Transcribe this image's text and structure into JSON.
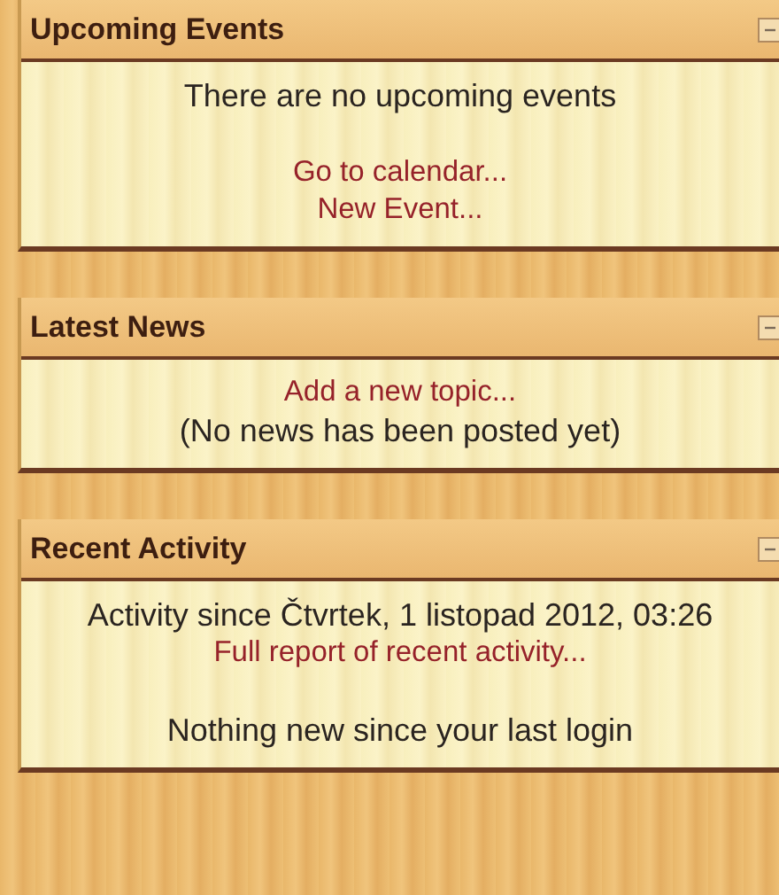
{
  "blocks": [
    {
      "title": "Upcoming Events",
      "expanded": true,
      "paragraphs": [
        [
          {
            "kind": "text",
            "text": "There are no upcoming events"
          }
        ],
        [
          {
            "kind": "link",
            "text": "Go to calendar..."
          },
          {
            "kind": "link",
            "text": "New Event..."
          }
        ]
      ]
    },
    {
      "title": "Latest News",
      "expanded": true,
      "paragraphs": [
        [
          {
            "kind": "link",
            "text": "Add a new topic..."
          },
          {
            "kind": "text",
            "text": "(No news has been posted yet)"
          }
        ]
      ]
    },
    {
      "title": "Recent Activity",
      "expanded": true,
      "paragraphs": [
        [
          {
            "kind": "text",
            "text": "Activity since Čtvrtek, 1 listopad 2012, 03:26"
          },
          {
            "kind": "link",
            "text": "Full report of recent activity..."
          }
        ],
        [
          {
            "kind": "text",
            "text": "Nothing new since your last login"
          }
        ]
      ]
    }
  ]
}
